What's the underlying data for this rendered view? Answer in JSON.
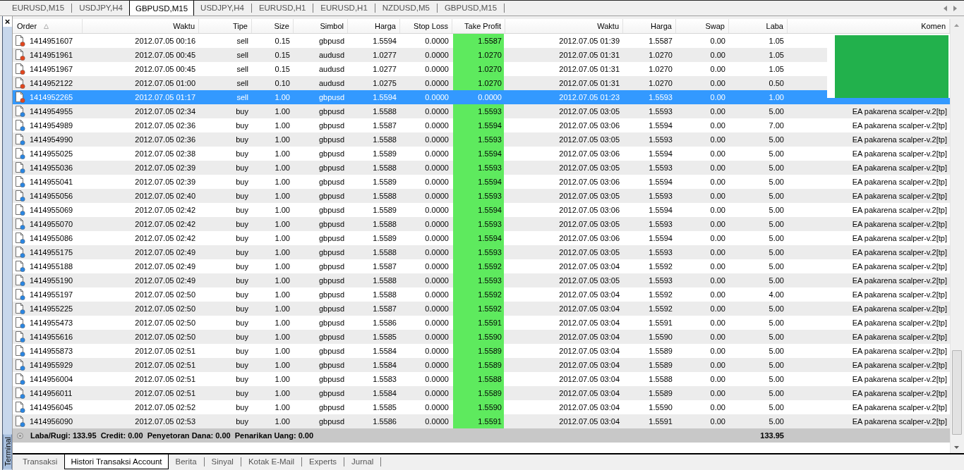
{
  "chart_tabs": [
    {
      "label": "EURUSD,M15",
      "selected": false
    },
    {
      "label": "USDJPY,H4",
      "selected": false
    },
    {
      "label": "GBPUSD,M15",
      "selected": true
    },
    {
      "label": "USDJPY,H4",
      "selected": false
    },
    {
      "label": "EURUSD,H1",
      "selected": false
    },
    {
      "label": "EURUSD,H1",
      "selected": false
    },
    {
      "label": "NZDUSD,M5",
      "selected": false
    },
    {
      "label": "GBPUSD,M15",
      "selected": false
    }
  ],
  "terminal": {
    "close": "×",
    "title": "Terminal"
  },
  "table": {
    "columns": [
      {
        "label": "Order",
        "sorted": true
      },
      {
        "label": "Waktu",
        "sorted": false
      },
      {
        "label": "Tipe",
        "sorted": false
      },
      {
        "label": "Size",
        "sorted": false
      },
      {
        "label": "Simbol",
        "sorted": false
      },
      {
        "label": "Harga",
        "sorted": false
      },
      {
        "label": "Stop Loss",
        "sorted": false
      },
      {
        "label": "Take Profit",
        "sorted": false
      },
      {
        "label": "Waktu",
        "sorted": false
      },
      {
        "label": "Harga",
        "sorted": false
      },
      {
        "label": "Swap",
        "sorted": false
      },
      {
        "label": "Laba",
        "sorted": false
      },
      {
        "label": "Komen",
        "sorted": false
      }
    ],
    "rows": [
      {
        "kind": "sell",
        "selected": false,
        "order": "1414951607",
        "open_time": "2012.07.05 00:16",
        "type": "sell",
        "size": "0.15",
        "symbol": "gbpusd",
        "open_price": "1.5594",
        "stop_loss": "0.0000",
        "take_profit": "1.5587",
        "tp_highlight": true,
        "close_time": "2012.07.05 01:39",
        "close_price": "1.5587",
        "swap": "0.00",
        "profit": "1.05"
      },
      {
        "kind": "sell",
        "selected": false,
        "order": "1414951961",
        "open_time": "2012.07.05 00:45",
        "type": "sell",
        "size": "0.15",
        "symbol": "audusd",
        "open_price": "1.0277",
        "stop_loss": "0.0000",
        "take_profit": "1.0270",
        "tp_highlight": true,
        "close_time": "2012.07.05 01:31",
        "close_price": "1.0270",
        "swap": "0.00",
        "profit": "1.05"
      },
      {
        "kind": "sell",
        "selected": false,
        "order": "1414951967",
        "open_time": "2012.07.05 00:45",
        "type": "sell",
        "size": "0.15",
        "symbol": "audusd",
        "open_price": "1.0277",
        "stop_loss": "0.0000",
        "take_profit": "1.0270",
        "tp_highlight": true,
        "close_time": "2012.07.05 01:31",
        "close_price": "1.0270",
        "swap": "0.00",
        "profit": "1.05"
      },
      {
        "kind": "sell",
        "selected": false,
        "order": "1414952122",
        "open_time": "2012.07.05 01:00",
        "type": "sell",
        "size": "0.10",
        "symbol": "audusd",
        "open_price": "1.0275",
        "stop_loss": "0.0000",
        "take_profit": "1.0270",
        "tp_highlight": true,
        "close_time": "2012.07.05 01:31",
        "close_price": "1.0270",
        "swap": "0.00",
        "profit": "0.50"
      },
      {
        "kind": "sell",
        "selected": true,
        "order": "1414952265",
        "open_time": "2012.07.05 01:17",
        "type": "sell",
        "size": "1.00",
        "symbol": "gbpusd",
        "open_price": "1.5594",
        "stop_loss": "0.0000",
        "take_profit": "0.0000",
        "tp_highlight": false,
        "close_time": "2012.07.05 01:23",
        "close_price": "1.5593",
        "swap": "0.00",
        "profit": "1.00"
      },
      {
        "kind": "buy",
        "selected": false,
        "order": "1414954955",
        "open_time": "2012.07.05 02:34",
        "type": "buy",
        "size": "1.00",
        "symbol": "gbpusd",
        "open_price": "1.5588",
        "stop_loss": "0.0000",
        "take_profit": "1.5593",
        "tp_highlight": true,
        "close_time": "2012.07.05 03:05",
        "close_price": "1.5593",
        "swap": "0.00",
        "profit": "5.00",
        "comment": "EA pakarena scalper-v.2[tp]"
      },
      {
        "kind": "buy",
        "selected": false,
        "order": "1414954989",
        "open_time": "2012.07.05 02:36",
        "type": "buy",
        "size": "1.00",
        "symbol": "gbpusd",
        "open_price": "1.5587",
        "stop_loss": "0.0000",
        "take_profit": "1.5594",
        "tp_highlight": true,
        "close_time": "2012.07.05 03:06",
        "close_price": "1.5594",
        "swap": "0.00",
        "profit": "7.00",
        "comment": "EA pakarena scalper-v.2[tp]"
      },
      {
        "kind": "buy",
        "selected": false,
        "order": "1414954990",
        "open_time": "2012.07.05 02:36",
        "type": "buy",
        "size": "1.00",
        "symbol": "gbpusd",
        "open_price": "1.5588",
        "stop_loss": "0.0000",
        "take_profit": "1.5593",
        "tp_highlight": true,
        "close_time": "2012.07.05 03:05",
        "close_price": "1.5593",
        "swap": "0.00",
        "profit": "5.00",
        "comment": "EA pakarena scalper-v.2[tp]"
      },
      {
        "kind": "buy",
        "selected": false,
        "order": "1414955025",
        "open_time": "2012.07.05 02:38",
        "type": "buy",
        "size": "1.00",
        "symbol": "gbpusd",
        "open_price": "1.5589",
        "stop_loss": "0.0000",
        "take_profit": "1.5594",
        "tp_highlight": true,
        "close_time": "2012.07.05 03:06",
        "close_price": "1.5594",
        "swap": "0.00",
        "profit": "5.00",
        "comment": "EA pakarena scalper-v.2[tp]"
      },
      {
        "kind": "buy",
        "selected": false,
        "order": "1414955036",
        "open_time": "2012.07.05 02:39",
        "type": "buy",
        "size": "1.00",
        "symbol": "gbpusd",
        "open_price": "1.5588",
        "stop_loss": "0.0000",
        "take_profit": "1.5593",
        "tp_highlight": true,
        "close_time": "2012.07.05 03:05",
        "close_price": "1.5593",
        "swap": "0.00",
        "profit": "5.00",
        "comment": "EA pakarena scalper-v.2[tp]"
      },
      {
        "kind": "buy",
        "selected": false,
        "order": "1414955041",
        "open_time": "2012.07.05 02:39",
        "type": "buy",
        "size": "1.00",
        "symbol": "gbpusd",
        "open_price": "1.5589",
        "stop_loss": "0.0000",
        "take_profit": "1.5594",
        "tp_highlight": true,
        "close_time": "2012.07.05 03:06",
        "close_price": "1.5594",
        "swap": "0.00",
        "profit": "5.00",
        "comment": "EA pakarena scalper-v.2[tp]"
      },
      {
        "kind": "buy",
        "selected": false,
        "order": "1414955056",
        "open_time": "2012.07.05 02:40",
        "type": "buy",
        "size": "1.00",
        "symbol": "gbpusd",
        "open_price": "1.5588",
        "stop_loss": "0.0000",
        "take_profit": "1.5593",
        "tp_highlight": true,
        "close_time": "2012.07.05 03:05",
        "close_price": "1.5593",
        "swap": "0.00",
        "profit": "5.00",
        "comment": "EA pakarena scalper-v.2[tp]"
      },
      {
        "kind": "buy",
        "selected": false,
        "order": "1414955069",
        "open_time": "2012.07.05 02:42",
        "type": "buy",
        "size": "1.00",
        "symbol": "gbpusd",
        "open_price": "1.5589",
        "stop_loss": "0.0000",
        "take_profit": "1.5594",
        "tp_highlight": true,
        "close_time": "2012.07.05 03:06",
        "close_price": "1.5594",
        "swap": "0.00",
        "profit": "5.00",
        "comment": "EA pakarena scalper-v.2[tp]"
      },
      {
        "kind": "buy",
        "selected": false,
        "order": "1414955070",
        "open_time": "2012.07.05 02:42",
        "type": "buy",
        "size": "1.00",
        "symbol": "gbpusd",
        "open_price": "1.5588",
        "stop_loss": "0.0000",
        "take_profit": "1.5593",
        "tp_highlight": true,
        "close_time": "2012.07.05 03:05",
        "close_price": "1.5593",
        "swap": "0.00",
        "profit": "5.00",
        "comment": "EA pakarena scalper-v.2[tp]"
      },
      {
        "kind": "buy",
        "selected": false,
        "order": "1414955086",
        "open_time": "2012.07.05 02:42",
        "type": "buy",
        "size": "1.00",
        "symbol": "gbpusd",
        "open_price": "1.5589",
        "stop_loss": "0.0000",
        "take_profit": "1.5594",
        "tp_highlight": true,
        "close_time": "2012.07.05 03:06",
        "close_price": "1.5594",
        "swap": "0.00",
        "profit": "5.00",
        "comment": "EA pakarena scalper-v.2[tp]"
      },
      {
        "kind": "buy",
        "selected": false,
        "order": "1414955175",
        "open_time": "2012.07.05 02:49",
        "type": "buy",
        "size": "1.00",
        "symbol": "gbpusd",
        "open_price": "1.5588",
        "stop_loss": "0.0000",
        "take_profit": "1.5593",
        "tp_highlight": true,
        "close_time": "2012.07.05 03:05",
        "close_price": "1.5593",
        "swap": "0.00",
        "profit": "5.00",
        "comment": "EA pakarena scalper-v.2[tp]"
      },
      {
        "kind": "buy",
        "selected": false,
        "order": "1414955188",
        "open_time": "2012.07.05 02:49",
        "type": "buy",
        "size": "1.00",
        "symbol": "gbpusd",
        "open_price": "1.5587",
        "stop_loss": "0.0000",
        "take_profit": "1.5592",
        "tp_highlight": true,
        "close_time": "2012.07.05 03:04",
        "close_price": "1.5592",
        "swap": "0.00",
        "profit": "5.00",
        "comment": "EA pakarena scalper-v.2[tp]"
      },
      {
        "kind": "buy",
        "selected": false,
        "order": "1414955190",
        "open_time": "2012.07.05 02:49",
        "type": "buy",
        "size": "1.00",
        "symbol": "gbpusd",
        "open_price": "1.5588",
        "stop_loss": "0.0000",
        "take_profit": "1.5593",
        "tp_highlight": true,
        "close_time": "2012.07.05 03:05",
        "close_price": "1.5593",
        "swap": "0.00",
        "profit": "5.00",
        "comment": "EA pakarena scalper-v.2[tp]"
      },
      {
        "kind": "buy",
        "selected": false,
        "order": "1414955197",
        "open_time": "2012.07.05 02:50",
        "type": "buy",
        "size": "1.00",
        "symbol": "gbpusd",
        "open_price": "1.5588",
        "stop_loss": "0.0000",
        "take_profit": "1.5592",
        "tp_highlight": true,
        "close_time": "2012.07.05 03:04",
        "close_price": "1.5592",
        "swap": "0.00",
        "profit": "4.00",
        "comment": "EA pakarena scalper-v.2[tp]"
      },
      {
        "kind": "buy",
        "selected": false,
        "order": "1414955225",
        "open_time": "2012.07.05 02:50",
        "type": "buy",
        "size": "1.00",
        "symbol": "gbpusd",
        "open_price": "1.5587",
        "stop_loss": "0.0000",
        "take_profit": "1.5592",
        "tp_highlight": true,
        "close_time": "2012.07.05 03:04",
        "close_price": "1.5592",
        "swap": "0.00",
        "profit": "5.00",
        "comment": "EA pakarena scalper-v.2[tp]"
      },
      {
        "kind": "buy",
        "selected": false,
        "order": "1414955473",
        "open_time": "2012.07.05 02:50",
        "type": "buy",
        "size": "1.00",
        "symbol": "gbpusd",
        "open_price": "1.5586",
        "stop_loss": "0.0000",
        "take_profit": "1.5591",
        "tp_highlight": true,
        "close_time": "2012.07.05 03:04",
        "close_price": "1.5591",
        "swap": "0.00",
        "profit": "5.00",
        "comment": "EA pakarena scalper-v.2[tp]"
      },
      {
        "kind": "buy",
        "selected": false,
        "order": "1414955616",
        "open_time": "2012.07.05 02:50",
        "type": "buy",
        "size": "1.00",
        "symbol": "gbpusd",
        "open_price": "1.5585",
        "stop_loss": "0.0000",
        "take_profit": "1.5590",
        "tp_highlight": true,
        "close_time": "2012.07.05 03:04",
        "close_price": "1.5590",
        "swap": "0.00",
        "profit": "5.00",
        "comment": "EA pakarena scalper-v.2[tp]"
      },
      {
        "kind": "buy",
        "selected": false,
        "order": "1414955873",
        "open_time": "2012.07.05 02:51",
        "type": "buy",
        "size": "1.00",
        "symbol": "gbpusd",
        "open_price": "1.5584",
        "stop_loss": "0.0000",
        "take_profit": "1.5589",
        "tp_highlight": true,
        "close_time": "2012.07.05 03:04",
        "close_price": "1.5589",
        "swap": "0.00",
        "profit": "5.00",
        "comment": "EA pakarena scalper-v.2[tp]"
      },
      {
        "kind": "buy",
        "selected": false,
        "order": "1414955929",
        "open_time": "2012.07.05 02:51",
        "type": "buy",
        "size": "1.00",
        "symbol": "gbpusd",
        "open_price": "1.5584",
        "stop_loss": "0.0000",
        "take_profit": "1.5589",
        "tp_highlight": true,
        "close_time": "2012.07.05 03:04",
        "close_price": "1.5589",
        "swap": "0.00",
        "profit": "5.00",
        "comment": "EA pakarena scalper-v.2[tp]"
      },
      {
        "kind": "buy",
        "selected": false,
        "order": "1414956004",
        "open_time": "2012.07.05 02:51",
        "type": "buy",
        "size": "1.00",
        "symbol": "gbpusd",
        "open_price": "1.5583",
        "stop_loss": "0.0000",
        "take_profit": "1.5588",
        "tp_highlight": true,
        "close_time": "2012.07.05 03:04",
        "close_price": "1.5588",
        "swap": "0.00",
        "profit": "5.00",
        "comment": "EA pakarena scalper-v.2[tp]"
      },
      {
        "kind": "buy",
        "selected": false,
        "order": "1414956011",
        "open_time": "2012.07.05 02:51",
        "type": "buy",
        "size": "1.00",
        "symbol": "gbpusd",
        "open_price": "1.5584",
        "stop_loss": "0.0000",
        "take_profit": "1.5589",
        "tp_highlight": true,
        "close_time": "2012.07.05 03:04",
        "close_price": "1.5589",
        "swap": "0.00",
        "profit": "5.00",
        "comment": "EA pakarena scalper-v.2[tp]"
      },
      {
        "kind": "buy",
        "selected": false,
        "order": "1414956045",
        "open_time": "2012.07.05 02:52",
        "type": "buy",
        "size": "1.00",
        "symbol": "gbpusd",
        "open_price": "1.5585",
        "stop_loss": "0.0000",
        "take_profit": "1.5590",
        "tp_highlight": true,
        "close_time": "2012.07.05 03:04",
        "close_price": "1.5590",
        "swap": "0.00",
        "profit": "5.00",
        "comment": "EA pakarena scalper-v.2[tp]"
      },
      {
        "kind": "buy",
        "selected": false,
        "order": "1414956090",
        "open_time": "2012.07.05 02:53",
        "type": "buy",
        "size": "1.00",
        "symbol": "gbpusd",
        "open_price": "1.5586",
        "stop_loss": "0.0000",
        "take_profit": "1.5591",
        "tp_highlight": true,
        "close_time": "2012.07.05 03:04",
        "close_price": "1.5591",
        "swap": "0.00",
        "profit": "5.00",
        "comment": "EA pakarena scalper-v.2[tp]"
      }
    ],
    "summary": {
      "text": "Laba/Rugi: 133.95  Credit: 0.00  Penyetoran Dana: 0.00  Penarikan Uang: 0.00",
      "total": "133.95"
    }
  },
  "bottom_tabs": [
    {
      "label": "Transaksi",
      "selected": false
    },
    {
      "label": "Histori Transaksi Account",
      "selected": true
    },
    {
      "label": "Berita",
      "selected": false
    },
    {
      "label": "Sinyal",
      "selected": false
    },
    {
      "label": "Kotak E-Mail",
      "selected": false
    },
    {
      "label": "Experts",
      "selected": false
    },
    {
      "label": "Jurnal",
      "selected": false
    }
  ]
}
